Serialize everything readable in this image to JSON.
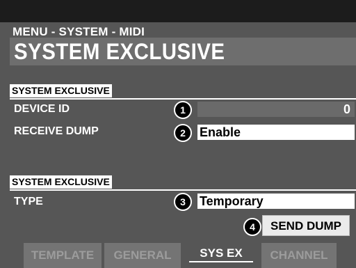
{
  "breadcrumb": "MENU - SYSTEM - MIDI",
  "title": "SYSTEM EXCLUSIVE",
  "sections": [
    {
      "header": "SYSTEM EXCLUSIVE",
      "rows": [
        {
          "label": "DEVICE ID",
          "badge": "1",
          "value": "0"
        },
        {
          "label": "RECEIVE DUMP",
          "badge": "2",
          "value": "Enable"
        }
      ]
    },
    {
      "header": "SYSTEM EXCLUSIVE",
      "rows": [
        {
          "label": "TYPE",
          "badge": "3",
          "value": "Temporary"
        }
      ]
    }
  ],
  "send_dump": {
    "badge": "4",
    "label": "SEND DUMP"
  },
  "tabs": [
    {
      "label": "TEMPLATE",
      "active": false
    },
    {
      "label": "GENERAL",
      "active": false
    },
    {
      "label": "SYS EX",
      "active": true
    },
    {
      "label": "CHANNEL",
      "active": false
    }
  ],
  "colors": {
    "screen_bg": "#565656",
    "highlight": "#ffffff",
    "badge_bg": "#000000"
  }
}
